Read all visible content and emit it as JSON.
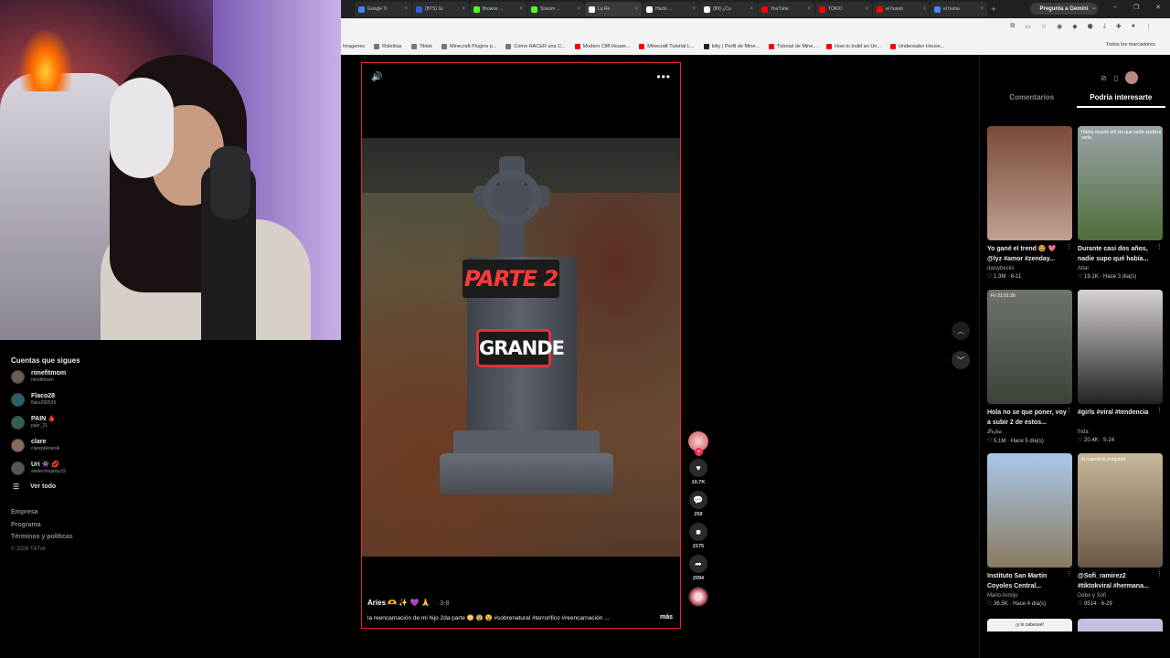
{
  "browser": {
    "tabs": [
      {
        "label": "Google Tr",
        "color": "#4285f4"
      },
      {
        "label": "(BTS) Gi",
        "color": "#3b5bdb"
      },
      {
        "label": "Browse ...",
        "color": "#53fc18"
      },
      {
        "label": "Stream ...",
        "color": "#53fc18"
      },
      {
        "label": "La Re",
        "color": "#ffffff",
        "active": true
      },
      {
        "label": "Hazlo ...",
        "color": "#ffffff"
      },
      {
        "label": "(89) ¿Cu",
        "color": "#ffffff"
      },
      {
        "label": "YouTube",
        "color": "#ff0000"
      },
      {
        "label": "TOKIO",
        "color": "#ff0000"
      },
      {
        "label": "el huevo",
        "color": "#ff0000"
      },
      {
        "label": "el huma",
        "color": "#4285f4"
      }
    ],
    "new_tab": "+",
    "ask_gemini": "Pregunta a Gemini",
    "window_controls": [
      "⌄",
      "–",
      "❐",
      "✕"
    ],
    "bookmarks": [
      {
        "label": "Imagenes",
        "color": ""
      },
      {
        "label": "Ruletitas",
        "color": "#777"
      },
      {
        "label": "Tiktok",
        "color": "#777"
      },
      {
        "label": "Minecraft Plugins p...",
        "color": "#777"
      },
      {
        "label": "Como HACER una C...",
        "color": "#777"
      },
      {
        "label": "Modern Cliff House...",
        "color": "#ff0000"
      },
      {
        "label": "Minecraft Tutorial L...",
        "color": "#ff0000"
      },
      {
        "label": "kitty | Perfil de Mine...",
        "color": "#222"
      },
      {
        "label": "Tutorial de Mine...",
        "color": "#ff0000"
      },
      {
        "label": "How to build an Un...",
        "color": "#ff0000"
      },
      {
        "label": "Underwater House...",
        "color": "#ff0000"
      }
    ],
    "all_bookmarks": "Todos los marcadores"
  },
  "sidebar": {
    "heading": "Cuentas que sigues",
    "accounts": [
      {
        "name": "rimefitmom",
        "handle": "rimefitmom",
        "color": "#6b5a4e"
      },
      {
        "name": "Flaco28",
        "handle": "flako280536",
        "color": "#2c5f66"
      },
      {
        "name": "PAIN 🩸",
        "handle": "pain_21",
        "color": "#345f4a"
      },
      {
        "name": "clare",
        "handle": "clarepekowski",
        "color": "#8a6a5a"
      },
      {
        "name": "Uri 👾 💋",
        "handle": "axelechegaray15",
        "color": "#555"
      }
    ],
    "see_all": "Ver todo",
    "footer": [
      "Empresa",
      "Programa",
      "Términos y políticas"
    ],
    "copyright": "© 2026 TikTok"
  },
  "video": {
    "label_parte": "PARTE 2",
    "label_grande": "GRANDE",
    "username": "Aries 🫶 ✨ 💜 🙏",
    "date": "· 3-8",
    "caption": "la reencarnación de mi hijo 2da parte 😳 😨 😮 #sobrenatural #terrorifico #reencarnación ...",
    "more": "más",
    "likes": "10.7K",
    "comments": "259",
    "saves": "2175",
    "shares": "2094"
  },
  "right_panel": {
    "tab_comments": "Comentarios",
    "tab_interest": "Podría interesarte",
    "cards": [
      {
        "title": "Yo gané el trend 🤩 💖 @lyz #amor #zenday...",
        "author": "daisybecks",
        "meta": "♡ 1.3M · 6-11",
        "overlay": "",
        "c1": "#7a4a3a",
        "c2": "#c0a090"
      },
      {
        "title": "Durante casi dos años, nadie supo qué había...",
        "author": "Altar",
        "meta": "♡ 19.1K · Hace 3 día(s)",
        "overlay": "Había muerto allí sin que nadie pudiera verla.",
        "c1": "#9aa3a8",
        "c2": "#4f6d3a"
      },
      {
        "title": "Hola no se que poner, voy a subir 2 de estos...",
        "author": "𝓢𝓸𝓯𝓲𝓪",
        "meta": "♡ 5.1M · Hace 5 día(s)",
        "overlay": "Fri 21:01:26",
        "c1": "#6e746d",
        "c2": "#3b4238"
      },
      {
        "title": "#girls #viral #tendencia",
        "author": "frida",
        "meta": "♡ 20.4K · 5-24",
        "overlay": "",
        "c1": "#d8d2d0",
        "c2": "#222"
      },
      {
        "title": "Instituto San Martin Coyoles Central...",
        "author": "Mario Armijo",
        "meta": "♡ 36.5K · Hace 4 día(s)",
        "overlay": "",
        "c1": "#a8c8e8",
        "c2": "#8a7a60"
      },
      {
        "title": "@Sofi_ramirez2 #tiktokviral #hermana...",
        "author": "Debo y Sofi",
        "meta": "♡ 9514 · 6-29",
        "overlay": "él cuando le pregunté",
        "c1": "#c8b89a",
        "c2": "#6a5848"
      }
    ],
    "peek_left": "¡y lo cabeceé!",
    "peek_right": ""
  }
}
